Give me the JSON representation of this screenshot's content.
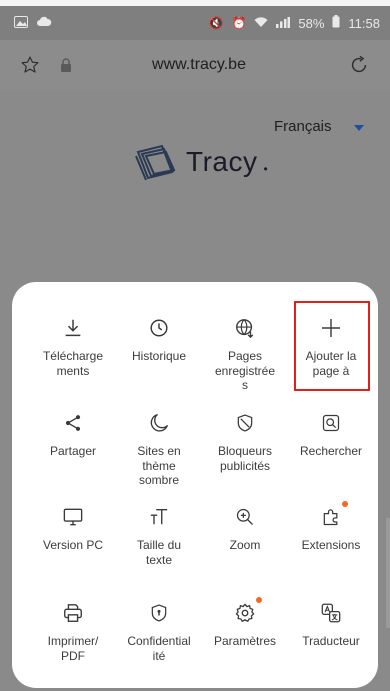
{
  "status_bar": {
    "battery": "58%",
    "time": "11:58"
  },
  "url_bar": {
    "url": "www.tracy.be"
  },
  "page": {
    "language": "Français",
    "logo_text": "Tracy"
  },
  "menu": {
    "items": [
      {
        "id": "downloads",
        "label": "Télécharge\nments",
        "icon": "download-icon"
      },
      {
        "id": "history",
        "label": "Historique",
        "icon": "clock-icon"
      },
      {
        "id": "saved-pages",
        "label": "Pages\nenregistrée\ns",
        "icon": "globe-download-icon"
      },
      {
        "id": "add-page",
        "label": "Ajouter la\npage à",
        "icon": "plus-icon"
      },
      {
        "id": "share",
        "label": "Partager",
        "icon": "share-icon"
      },
      {
        "id": "dark-mode",
        "label": "Sites en\nthème\nsombre",
        "icon": "moon-icon"
      },
      {
        "id": "ad-blockers",
        "label": "Bloqueurs\npublicités",
        "icon": "shield-icon"
      },
      {
        "id": "find",
        "label": "Rechercher",
        "icon": "find-on-page-icon"
      },
      {
        "id": "desktop",
        "label": "Version PC",
        "icon": "desktop-icon"
      },
      {
        "id": "text-size",
        "label": "Taille du\ntexte",
        "icon": "text-size-icon"
      },
      {
        "id": "zoom",
        "label": "Zoom",
        "icon": "zoom-icon"
      },
      {
        "id": "extensions",
        "label": "Extensions",
        "icon": "puzzle-icon"
      },
      {
        "id": "print",
        "label": "Imprimer/\nPDF",
        "icon": "printer-icon"
      },
      {
        "id": "privacy",
        "label": "Confidential\nité",
        "icon": "privacy-shield-icon"
      },
      {
        "id": "settings",
        "label": "Paramètres",
        "icon": "gear-icon"
      },
      {
        "id": "translator",
        "label": "Traducteur",
        "icon": "translate-icon"
      }
    ]
  },
  "colors": {
    "notification_dot": "#f06b25",
    "highlight_border": "#e0201c",
    "language_caret": "#1e4fa0"
  }
}
